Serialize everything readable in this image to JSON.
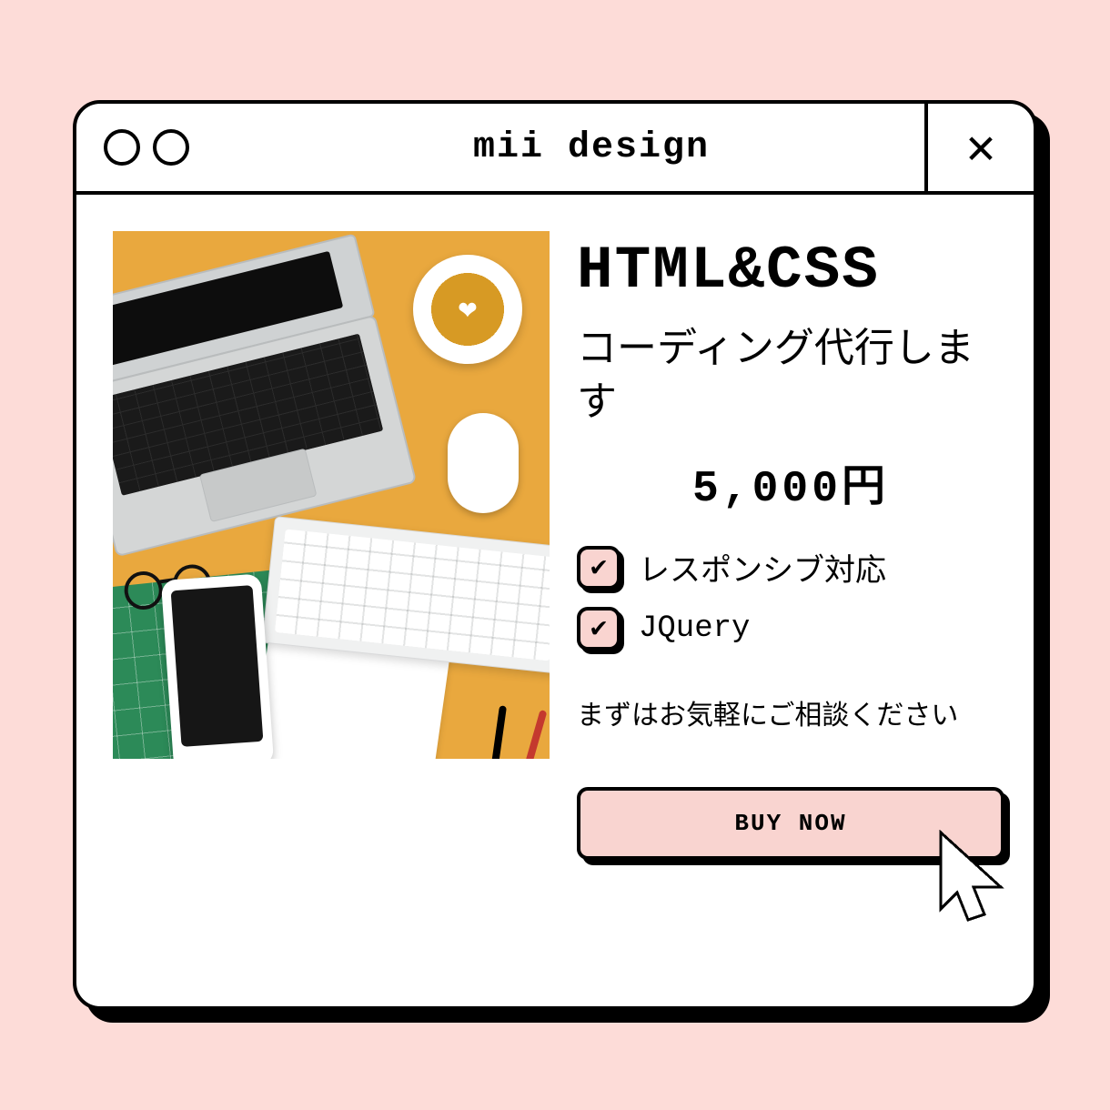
{
  "window": {
    "title": "mii design",
    "close_label": "✕"
  },
  "card": {
    "heading": "HTML&CSS",
    "subtitle": "コーディング代行します",
    "price": "5,000円",
    "features": [
      {
        "checked": true,
        "label": "レスポンシブ対応"
      },
      {
        "checked": true,
        "label": "JQuery"
      }
    ],
    "note": "まずはお気軽にご相談ください",
    "buy_label": "BUY NOW"
  },
  "colors": {
    "page_bg": "#fddcd8",
    "window_bg": "#ffffff",
    "accent_pink": "#f9d4d0",
    "desk_yellow": "#e9a83e",
    "mat_green": "#2c8a58"
  }
}
